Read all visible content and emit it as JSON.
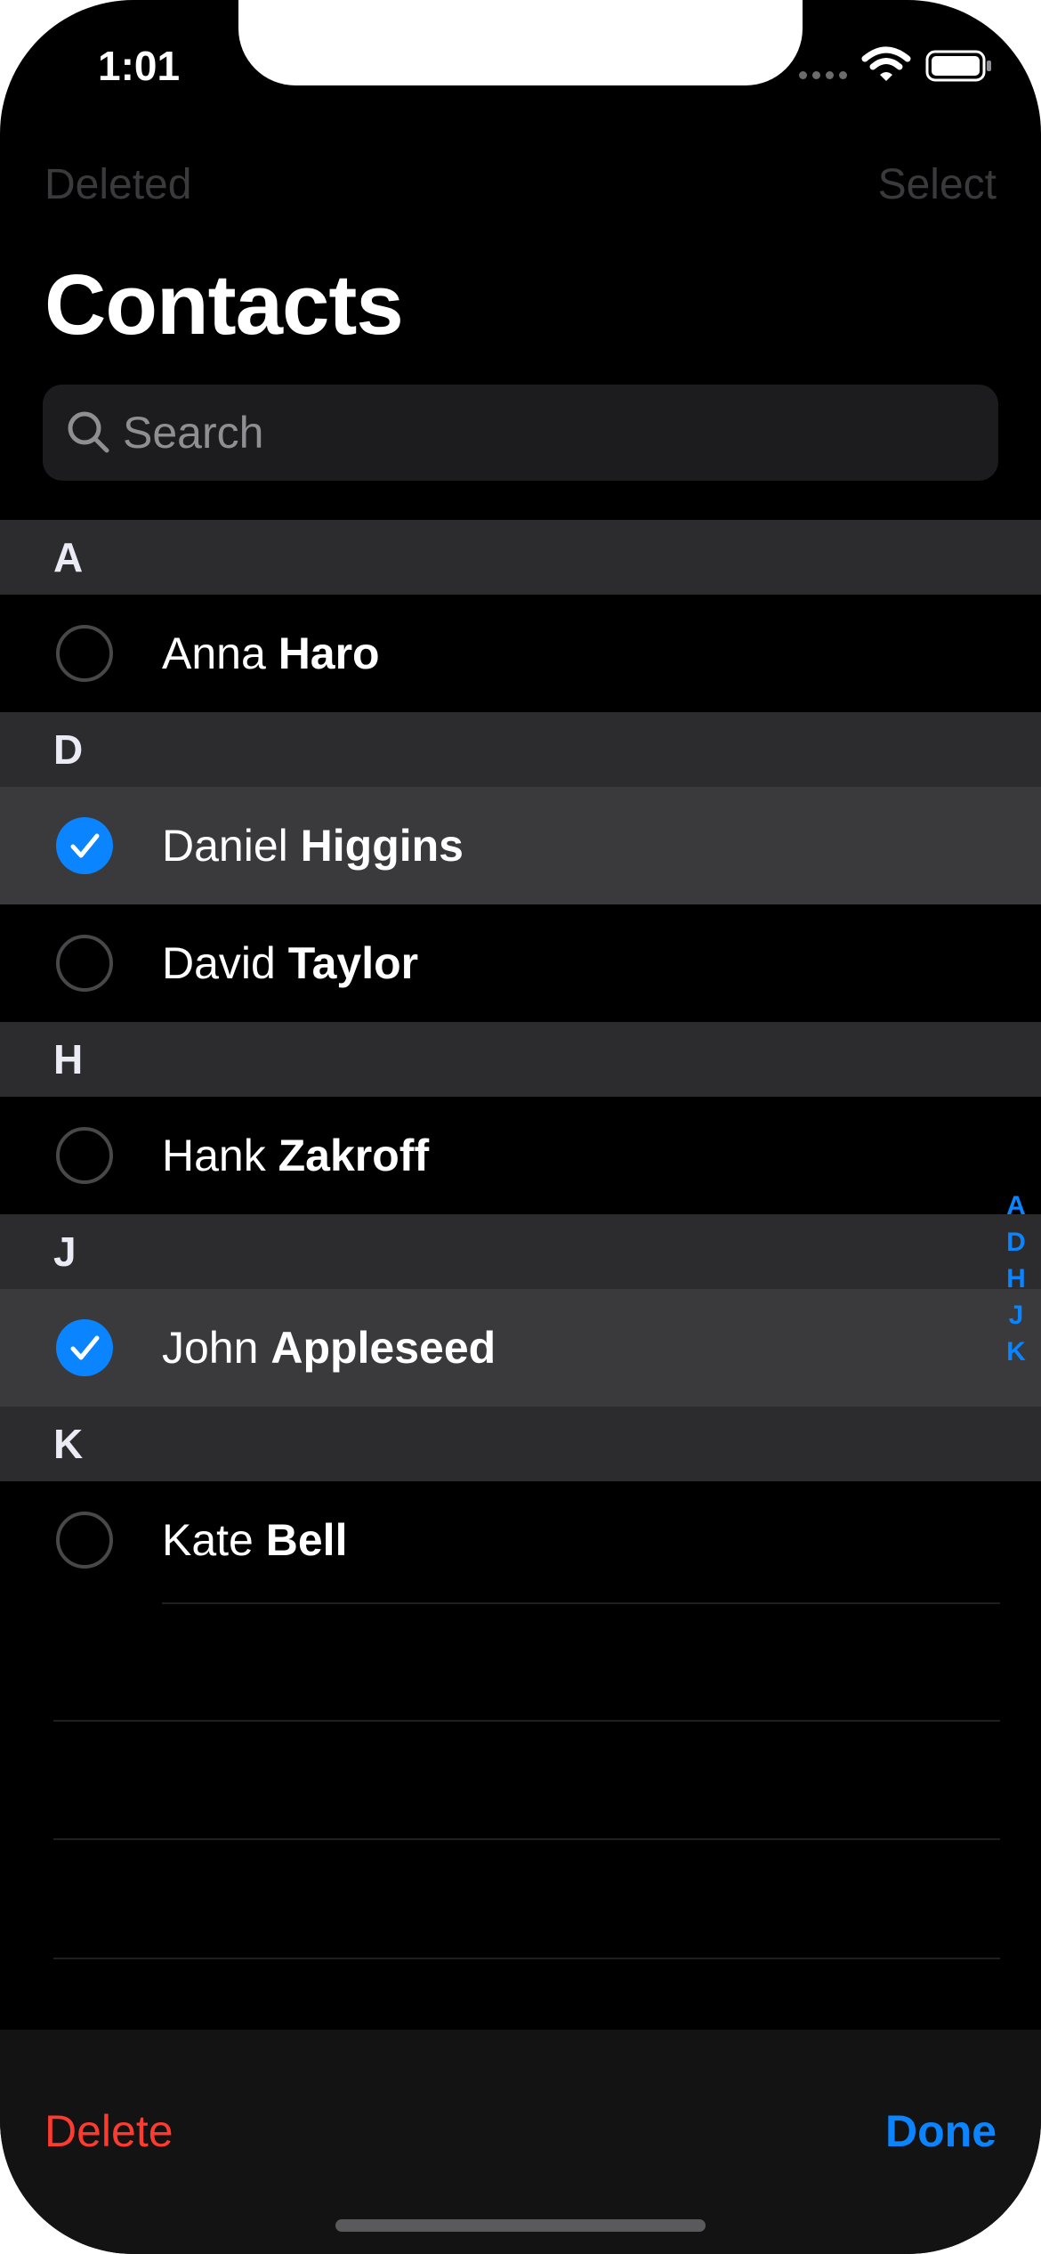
{
  "status_bar": {
    "time": "1:01"
  },
  "nav": {
    "left_label": "Deleted",
    "right_label": "Select"
  },
  "title": "Contacts",
  "search": {
    "placeholder": "Search"
  },
  "sections": [
    {
      "letter": "A",
      "contacts": [
        {
          "first": "Anna",
          "last": "Haro",
          "selected": false
        }
      ]
    },
    {
      "letter": "D",
      "contacts": [
        {
          "first": "Daniel",
          "last": "Higgins",
          "selected": true
        },
        {
          "first": "David",
          "last": "Taylor",
          "selected": false
        }
      ]
    },
    {
      "letter": "H",
      "contacts": [
        {
          "first": "Hank",
          "last": "Zakroff",
          "selected": false
        }
      ]
    },
    {
      "letter": "J",
      "contacts": [
        {
          "first": "John",
          "last": "Appleseed",
          "selected": true
        }
      ]
    },
    {
      "letter": "K",
      "contacts": [
        {
          "first": "Kate",
          "last": "Bell",
          "selected": false
        }
      ]
    }
  ],
  "index_letters": [
    "A",
    "D",
    "H",
    "J",
    "K"
  ],
  "toolbar": {
    "delete_label": "Delete",
    "done_label": "Done"
  },
  "colors": {
    "accent": "#0a84ff",
    "destructive": "#ff3b30",
    "selected_row": "#3a3a3c",
    "section_header": "#2c2c2e"
  }
}
